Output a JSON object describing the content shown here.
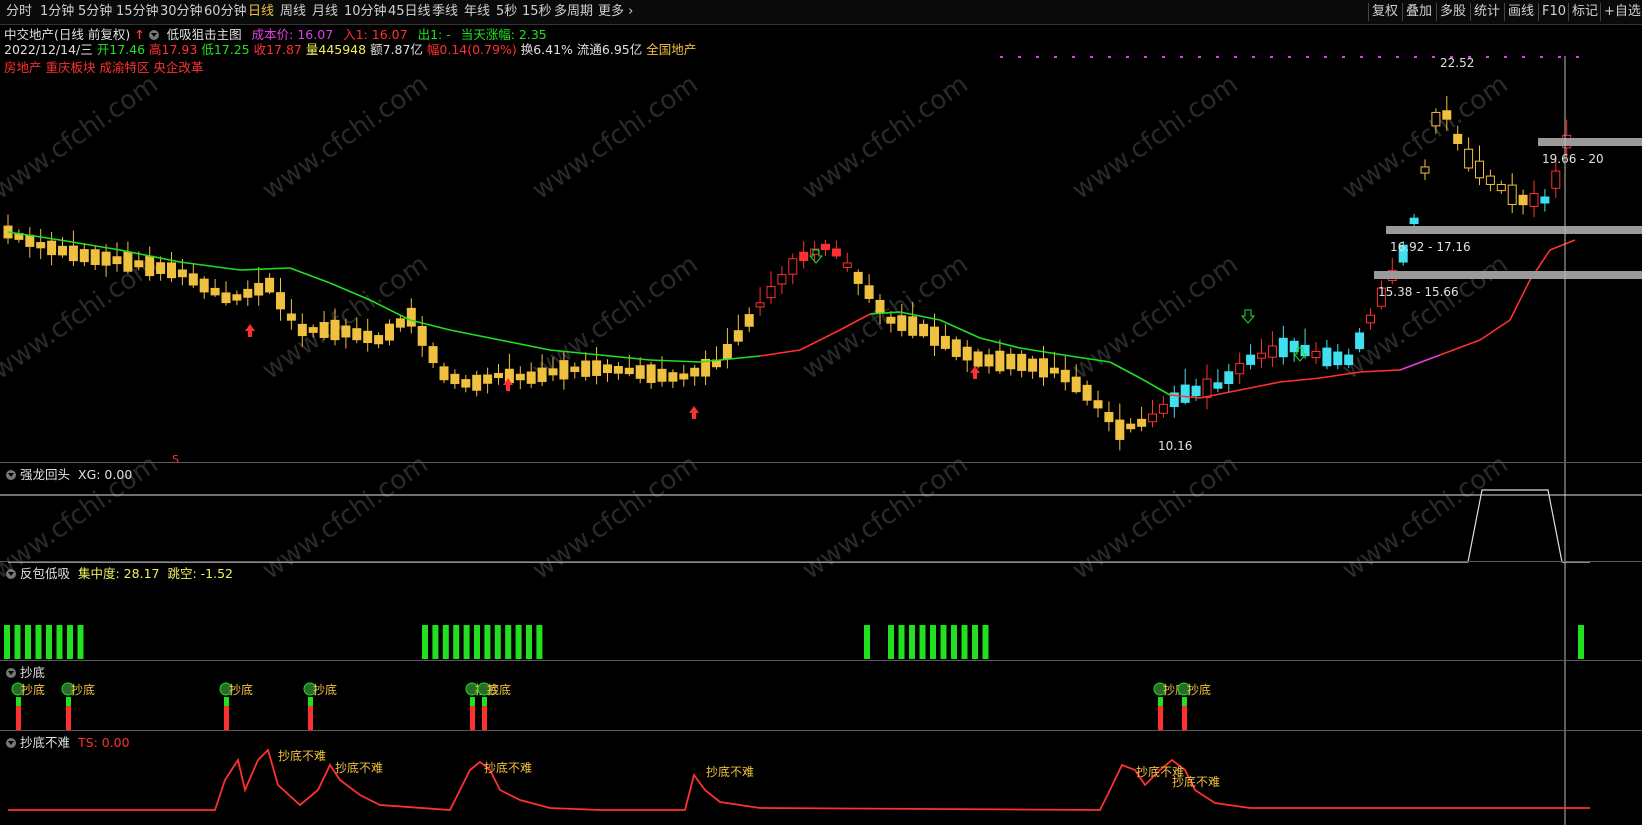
{
  "toolbar": {
    "left_items": [
      "分时",
      "1分钟",
      "5分钟",
      "15分钟",
      "30分钟",
      "60分钟",
      "日线",
      "周线",
      "月线",
      "10分钟",
      "45日线",
      "季线",
      "年线",
      "5秒",
      "15秒",
      "多周期",
      "更多"
    ],
    "active": "日线",
    "right_items": [
      "复权",
      "叠加",
      "多股",
      "统计",
      "画线",
      "F10",
      "标记",
      "+自选"
    ]
  },
  "header": {
    "stock_name": "中交地产(日线 前复权)",
    "indicator_name": "低吸狙击主图",
    "cost_label": "成本价: 16.07",
    "in_label": "入1: 16.07",
    "out_label": "出1: -",
    "limit_label": "当天涨幅: 2.35",
    "date": "2022/12/14/三",
    "open": "开17.46",
    "high": "高17.93",
    "low": "低17.25",
    "close": "收17.87",
    "volume": "量445948",
    "amount": "额7.87亿",
    "change": "幅0.14(0.79%)",
    "turnover": "换6.41%",
    "float": "流通6.95亿",
    "sector": "全国地产",
    "tags": "房地产 重庆板块 成渝特区 央企改革"
  },
  "main_chart": {
    "high_label": "22.52",
    "low_label": "10.16",
    "zones": [
      "19.66 - 20",
      "16.92 - 17.16",
      "15.38 - 15.66"
    ],
    "s_mark": "S",
    "watermark": "www.cfchi.com"
  },
  "panels": {
    "p1": {
      "title": "强龙回头",
      "value": "XG: 0.00"
    },
    "p2": {
      "title": "反包低吸",
      "value1": "集中度: 28.17",
      "value2": "跳空: -1.52"
    },
    "p3": {
      "title": "抄底",
      "label": "抄底"
    },
    "p4": {
      "title": "抄底不难",
      "value": "TS: 0.00",
      "label": "抄底不难"
    }
  },
  "colors": {
    "up": "#ff3030",
    "down": "#40e0f0",
    "yellow": "#f0c040",
    "green": "#20e020",
    "magenta": "#e040e0"
  }
}
